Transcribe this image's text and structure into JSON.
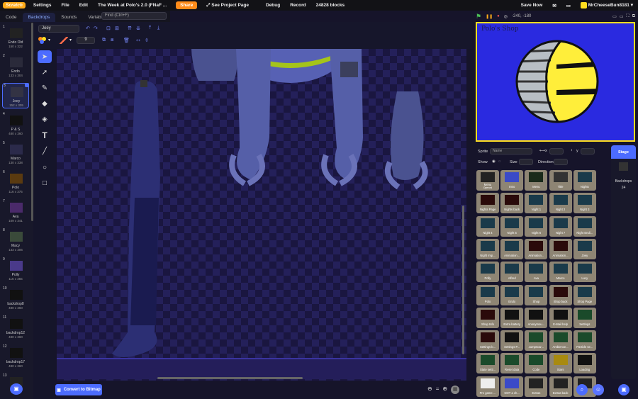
{
  "menubar": {
    "logo": "Scratch",
    "settings": "Settings",
    "file": "File",
    "edit": "Edit",
    "project_title": "The Week at Polo's 2.0 (FNaF ...",
    "share": "Share",
    "see_project": "See Project Page",
    "debug": "Debug",
    "record": "Record",
    "blocks": "24828 blocks",
    "save_now": "Save Now",
    "username": "MrCheeseBun8181"
  },
  "tabs": {
    "code": "Code",
    "backdrops": "Backdrops",
    "sounds": "Sounds",
    "variables": "Variables"
  },
  "find": {
    "placeholder": "Find (Ctrl+F)"
  },
  "costumes": [
    {
      "num": "1",
      "name": "Endo Old",
      "size": "150 x 322"
    },
    {
      "num": "2",
      "name": "Endo",
      "size": "133 x 304"
    },
    {
      "num": "3",
      "name": "Joey",
      "size": "152 x 305"
    },
    {
      "num": "4",
      "name": "P & S",
      "size": "480 x 360"
    },
    {
      "num": "5",
      "name": "Marco",
      "size": "130 x 338"
    },
    {
      "num": "6",
      "name": "Polo",
      "size": "116 x 375"
    },
    {
      "num": "7",
      "name": "Ava",
      "size": "109 x 341"
    },
    {
      "num": "8",
      "name": "Macy",
      "size": "133 x 306"
    },
    {
      "num": "9",
      "name": "Polly",
      "size": "115 x 355"
    },
    {
      "num": "10",
      "name": "backdrop8",
      "size": "480 x 360"
    },
    {
      "num": "11",
      "name": "backdrop12",
      "size": "480 x 360"
    },
    {
      "num": "12",
      "name": "backdrop17",
      "size": "480 x 360"
    },
    {
      "num": "13",
      "name": "",
      "size": ""
    }
  ],
  "editor": {
    "costume_name": "Joey",
    "outline_width": "9",
    "convert": "Convert to Bitmap"
  },
  "stage": {
    "coords": "-240, -180",
    "title": "Polo's Shop"
  },
  "sprite_info": {
    "sprite_label": "Sprite",
    "sprite_placeholder": "Name",
    "x_label": "x",
    "y_label": "y",
    "show_label": "Show",
    "size_label": "Size",
    "direction_label": "Direction"
  },
  "sprites": [
    "Menu",
    "Intro",
    "Menu",
    "Title",
    "Nights",
    "Nights Page",
    "Nights back",
    "Night 1",
    "Night 2",
    "Night 3",
    "Night 4",
    "Night 5",
    "Night 6",
    "Night 7",
    "Night Endi...",
    "Night Imp...",
    "Animation...",
    "Animation...",
    "Animation...",
    "Joey",
    "Polly",
    "Alfred",
    "Ava",
    "Marco",
    "Lucy",
    "Polo",
    "Endo",
    "Shop",
    "Shop back",
    "Shop Page",
    "Shop Info",
    "Extra battery",
    "Anonymou...",
    "E-Mail help",
    "Settings",
    "Settings b...",
    "Settings P...",
    "Jumpscar...",
    "Ambience...",
    "Particle se...",
    "State setti...",
    "Reset data",
    "Code",
    "Stars",
    "Loading",
    "Pre game ...",
    "NOT a ch...",
    "Extras",
    "Extras back",
    ""
  ],
  "sprite_sub": {
    "menu_opened": "Opened"
  },
  "stage_panel": {
    "label": "Stage",
    "backdrops_label": "Backdrops",
    "backdrops_count": "24"
  },
  "colors": {
    "accent": "#4c6cff",
    "stage_border": "#ffde1f",
    "stage_bg": "#2a2ae0"
  }
}
